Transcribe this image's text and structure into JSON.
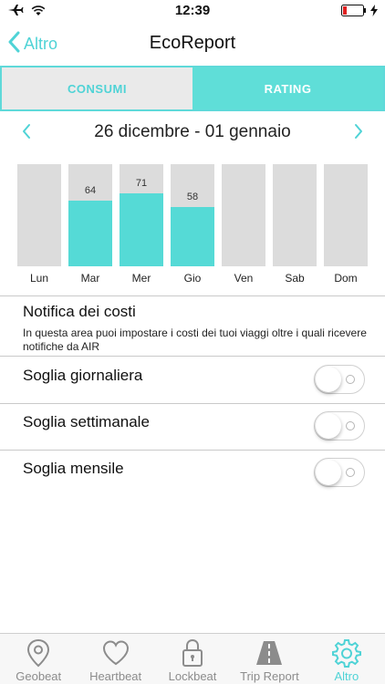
{
  "status": {
    "time": "12:39",
    "icons": [
      "airplane-icon",
      "wifi-icon",
      "battery-low-icon",
      "charging-icon"
    ]
  },
  "nav": {
    "back_label": "Altro",
    "title": "EcoReport"
  },
  "segment": {
    "tabs": [
      "CONSUMI",
      "RATING"
    ],
    "active": "RATING"
  },
  "date_range": "26 dicembre - 01 gennaio",
  "chart_data": {
    "type": "bar",
    "categories": [
      "Lun",
      "Mar",
      "Mer",
      "Gio",
      "Ven",
      "Sab",
      "Dom"
    ],
    "values": [
      null,
      64,
      71,
      58,
      null,
      null,
      null
    ],
    "value_labels": [
      "",
      "64",
      "71",
      "58",
      "",
      "",
      ""
    ],
    "ylim": [
      0,
      100
    ],
    "colors": {
      "bar": "#55dad6",
      "track": "#dcdcdc"
    }
  },
  "notify": {
    "title": "Notifica dei costi",
    "description": "In questa area puoi impostare i costi dei tuoi viaggi oltre i quali ricevere notifiche da AIR"
  },
  "thresholds": [
    {
      "label": "Soglia giornaliera",
      "on": false
    },
    {
      "label": "Soglia settimanale",
      "on": false
    },
    {
      "label": "Soglia mensile",
      "on": false
    }
  ],
  "tabbar": {
    "items": [
      {
        "label": "Geobeat",
        "icon": "location-pin-icon"
      },
      {
        "label": "Heartbeat",
        "icon": "heart-icon"
      },
      {
        "label": "Lockbeat",
        "icon": "lock-icon"
      },
      {
        "label": "Trip Report",
        "icon": "road-icon"
      },
      {
        "label": "Altro",
        "icon": "gear-icon"
      }
    ],
    "active": "Altro"
  },
  "colors": {
    "accent": "#4fd3d6",
    "segment_active": "#5fded8"
  }
}
